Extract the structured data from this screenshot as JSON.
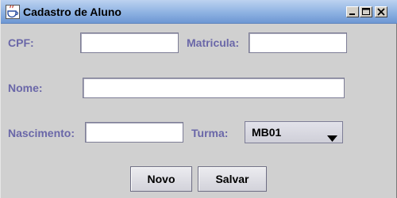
{
  "window": {
    "title": "Cadastro de Aluno",
    "controls": {
      "minimize_icon": "minimize-icon",
      "maximize_icon": "maximize-icon",
      "close_icon": "close-icon"
    }
  },
  "form": {
    "cpf": {
      "label": "CPF:",
      "value": ""
    },
    "matricula": {
      "label": "Matricula:",
      "value": ""
    },
    "nome": {
      "label": "Nome:",
      "value": ""
    },
    "nascimento": {
      "label": "Nascimento:",
      "value": ""
    },
    "turma": {
      "label": "Turma:",
      "selected": "MB01"
    }
  },
  "buttons": {
    "novo": "Novo",
    "salvar": "Salvar"
  },
  "colors": {
    "label_text": "#6a67a8",
    "title_bar": "#8eb2e2",
    "panel": "#d0d0d0"
  }
}
